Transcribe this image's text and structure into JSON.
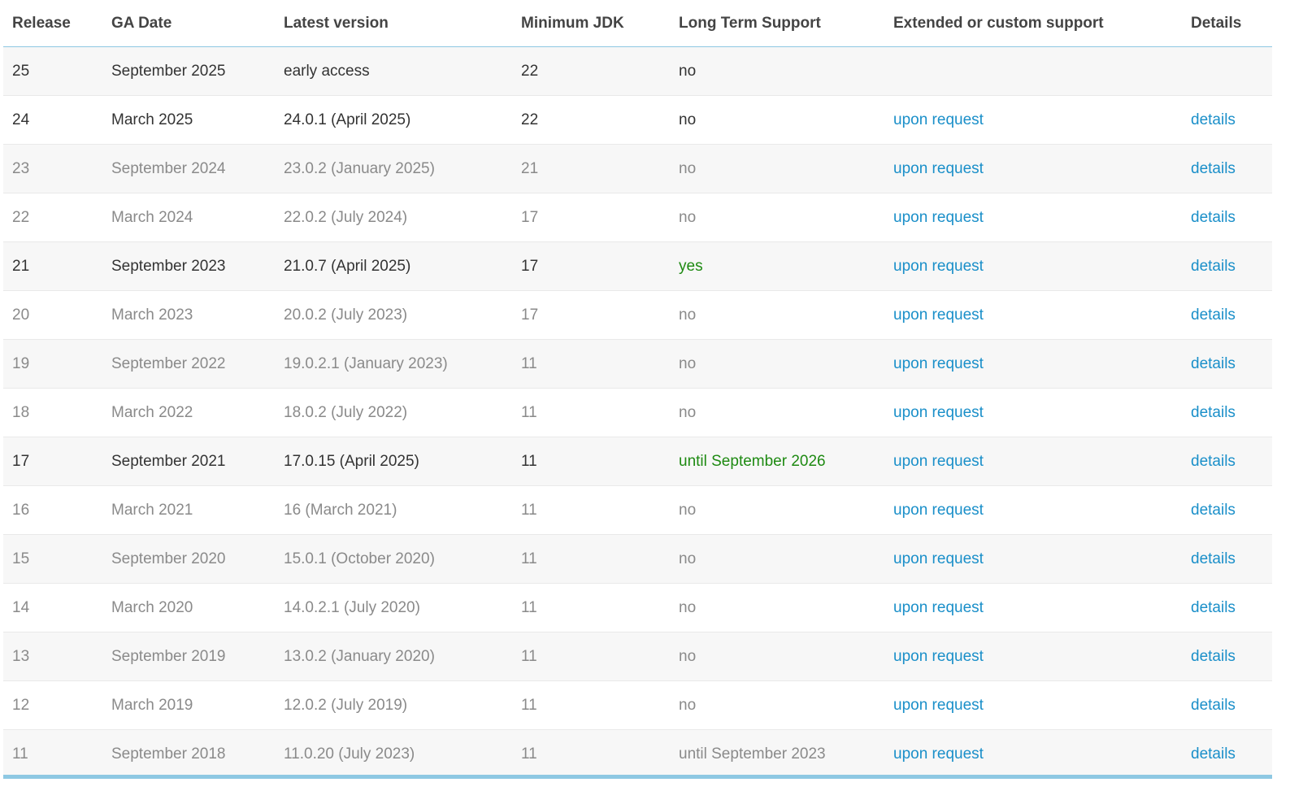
{
  "table": {
    "headers": [
      "Release",
      "GA Date",
      "Latest version",
      "Minimum JDK",
      "Long Term Support",
      "Extended or custom support",
      "Details"
    ],
    "rows": [
      {
        "release": "25",
        "ga_date": "September 2025",
        "latest_version": "early access",
        "min_jdk": "22",
        "lts": "no",
        "extended": "",
        "details": "",
        "status": "current",
        "lts_highlight": false
      },
      {
        "release": "24",
        "ga_date": "March 2025",
        "latest_version": "24.0.1 (April 2025)",
        "min_jdk": "22",
        "lts": "no",
        "extended": "upon request",
        "details": "details",
        "status": "current",
        "lts_highlight": false
      },
      {
        "release": "23",
        "ga_date": "September 2024",
        "latest_version": "23.0.2 (January 2025)",
        "min_jdk": "21",
        "lts": "no",
        "extended": "upon request",
        "details": "details",
        "status": "old",
        "lts_highlight": false
      },
      {
        "release": "22",
        "ga_date": "March 2024",
        "latest_version": "22.0.2 (July 2024)",
        "min_jdk": "17",
        "lts": "no",
        "extended": "upon request",
        "details": "details",
        "status": "old",
        "lts_highlight": false
      },
      {
        "release": "21",
        "ga_date": "September 2023",
        "latest_version": "21.0.7 (April 2025)",
        "min_jdk": "17",
        "lts": "yes",
        "extended": "upon request",
        "details": "details",
        "status": "current",
        "lts_highlight": true
      },
      {
        "release": "20",
        "ga_date": "March 2023",
        "latest_version": "20.0.2 (July 2023)",
        "min_jdk": "17",
        "lts": "no",
        "extended": "upon request",
        "details": "details",
        "status": "old",
        "lts_highlight": false
      },
      {
        "release": "19",
        "ga_date": "September 2022",
        "latest_version": "19.0.2.1 (January 2023)",
        "min_jdk": "11",
        "lts": "no",
        "extended": "upon request",
        "details": "details",
        "status": "old",
        "lts_highlight": false
      },
      {
        "release": "18",
        "ga_date": "March 2022",
        "latest_version": "18.0.2 (July 2022)",
        "min_jdk": "11",
        "lts": "no",
        "extended": "upon request",
        "details": "details",
        "status": "old",
        "lts_highlight": false
      },
      {
        "release": "17",
        "ga_date": "September 2021",
        "latest_version": "17.0.15 (April 2025)",
        "min_jdk": "11",
        "lts": "until September 2026",
        "extended": "upon request",
        "details": "details",
        "status": "current",
        "lts_highlight": true
      },
      {
        "release": "16",
        "ga_date": "March 2021",
        "latest_version": "16 (March 2021)",
        "min_jdk": "11",
        "lts": "no",
        "extended": "upon request",
        "details": "details",
        "status": "old",
        "lts_highlight": false
      },
      {
        "release": "15",
        "ga_date": "September 2020",
        "latest_version": "15.0.1 (October 2020)",
        "min_jdk": "11",
        "lts": "no",
        "extended": "upon request",
        "details": "details",
        "status": "old",
        "lts_highlight": false
      },
      {
        "release": "14",
        "ga_date": "March 2020",
        "latest_version": "14.0.2.1 (July 2020)",
        "min_jdk": "11",
        "lts": "no",
        "extended": "upon request",
        "details": "details",
        "status": "old",
        "lts_highlight": false
      },
      {
        "release": "13",
        "ga_date": "September 2019",
        "latest_version": "13.0.2 (January 2020)",
        "min_jdk": "11",
        "lts": "no",
        "extended": "upon request",
        "details": "details",
        "status": "old",
        "lts_highlight": false
      },
      {
        "release": "12",
        "ga_date": "March 2019",
        "latest_version": "12.0.2 (July 2019)",
        "min_jdk": "11",
        "lts": "no",
        "extended": "upon request",
        "details": "details",
        "status": "old",
        "lts_highlight": false
      },
      {
        "release": "11",
        "ga_date": "September 2018",
        "latest_version": "11.0.20 (July 2023)",
        "min_jdk": "11",
        "lts": "until September 2023",
        "extended": "upon request",
        "details": "details",
        "status": "old",
        "lts_highlight": false
      }
    ]
  },
  "colors": {
    "text_current": "#333333",
    "text_old": "#8a8a8a",
    "lts_green": "#1e8a12",
    "link_blue": "#1a8fc9",
    "accent_border": "#8ec8e3",
    "row_stripe": "#f7f7f7"
  }
}
